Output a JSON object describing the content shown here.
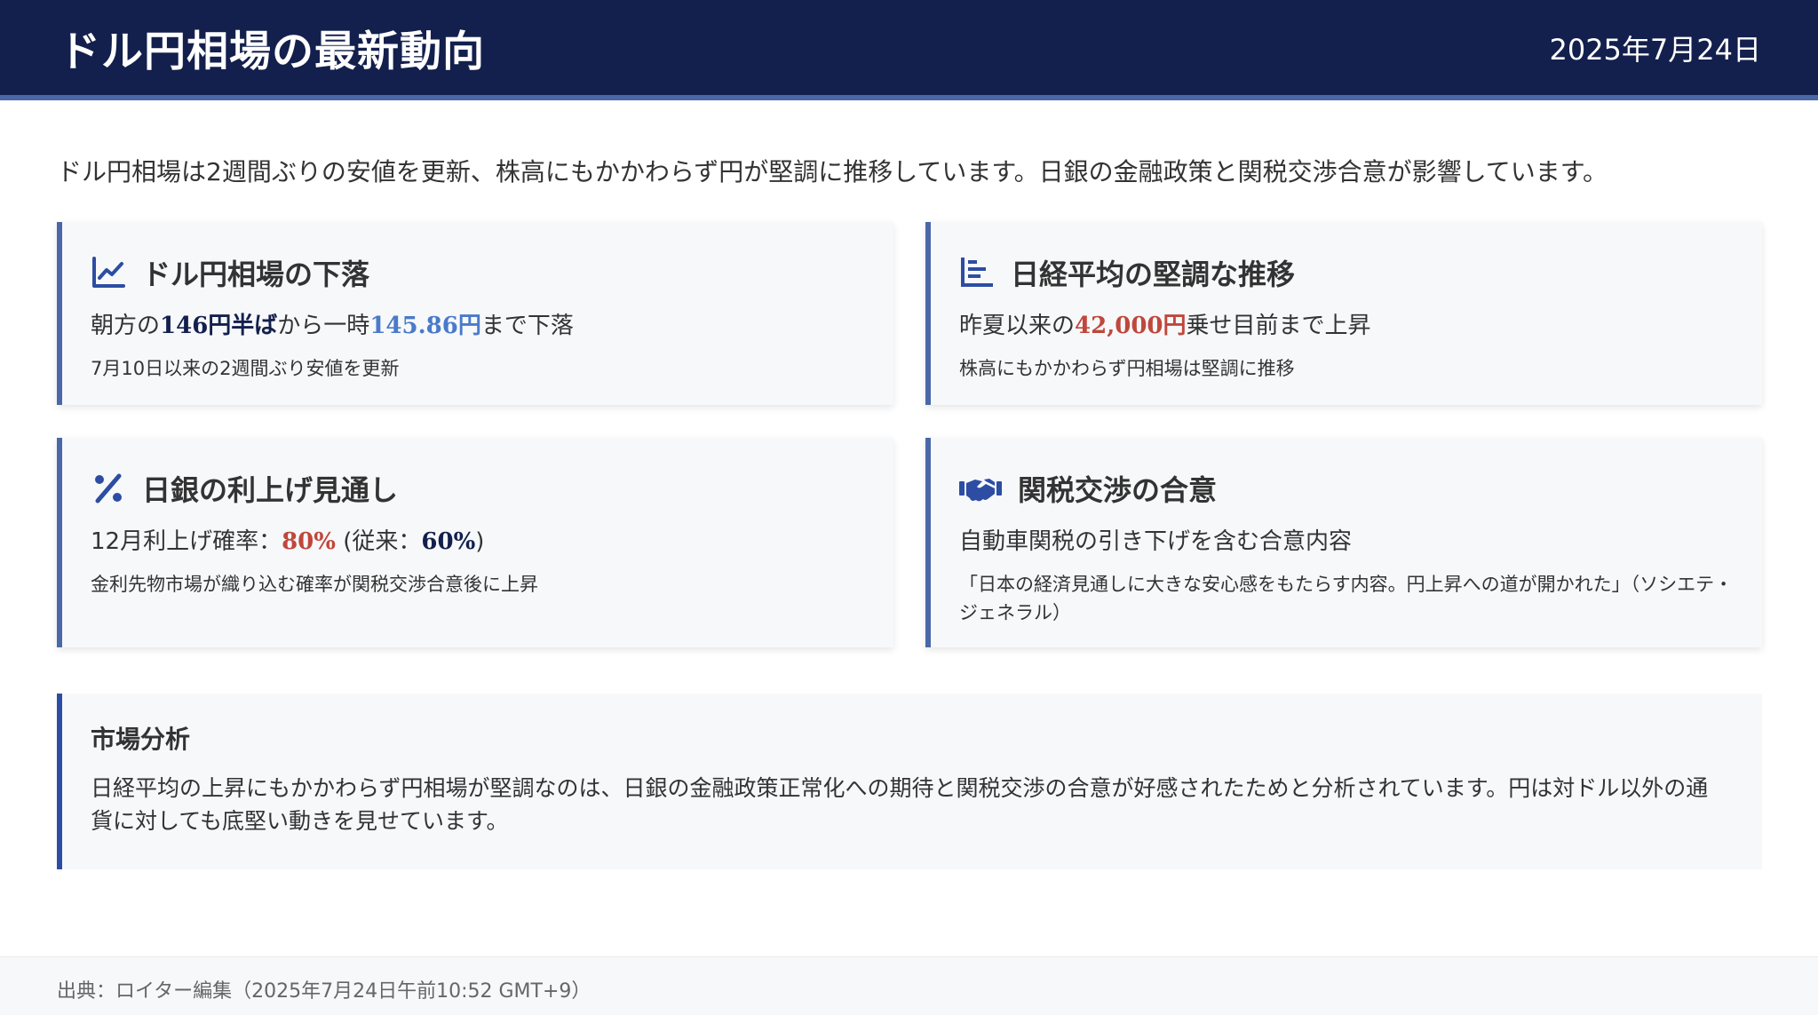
{
  "header": {
    "title": "ドル円相場の最新動向",
    "date": "2025年7月24日"
  },
  "intro": "ドル円相場は2週間ぶりの安値を更新、株高にもかかわらず円が堅調に推移しています。日銀の金融政策と関税交渉合意が影響しています。",
  "cards": [
    {
      "icon": "chart-line-icon",
      "title": "ドル円相場の下落",
      "main_pre": "朝方の",
      "main_val1": "146円半ば",
      "main_mid": "から一時",
      "main_val2": "145.86円",
      "main_post": "まで下落",
      "sub": "7月10日以来の2週間ぶり安値を更新"
    },
    {
      "icon": "bars-chart-icon",
      "title": "日経平均の堅調な推移",
      "main_pre": "昨夏以来の",
      "main_val1": "42,000円",
      "main_post": "乗せ目前まで上昇",
      "sub": "株高にもかかわらず円相場は堅調に推移"
    },
    {
      "icon": "percent-icon",
      "title": "日銀の利上げ見通し",
      "main_pre": "12月利上げ確率：",
      "main_val1": "80%",
      "main_mid": " (従来：",
      "main_val2": "60%",
      "main_post": ")",
      "sub": "金利先物市場が織り込む確率が関税交渉合意後に上昇"
    },
    {
      "icon": "handshake-icon",
      "title": "関税交渉の合意",
      "main_pre": "自動車関税の引き下げを含む合意内容",
      "sub": "「日本の経済見通しに大きな安心感をもたらす内容。円上昇への道が開かれた」（ソシエテ・ジェネラル）"
    }
  ],
  "analysis": {
    "title": "市場分析",
    "text": "日経平均の上昇にもかかわらず円相場が堅調なのは、日銀の金融政策正常化への期待と関税交渉の合意が好感されたためと分析されています。円は対ドル以外の通貨に対しても底堅い動きを見せています。"
  },
  "footer": "出典：ロイター編集（2025年7月24日午前10:52 GMT+9）",
  "colors": {
    "header_bg": "#13204d",
    "accent": "#4a67a8",
    "blue_value": "#4a7ac9",
    "red_value": "#c0473c"
  }
}
